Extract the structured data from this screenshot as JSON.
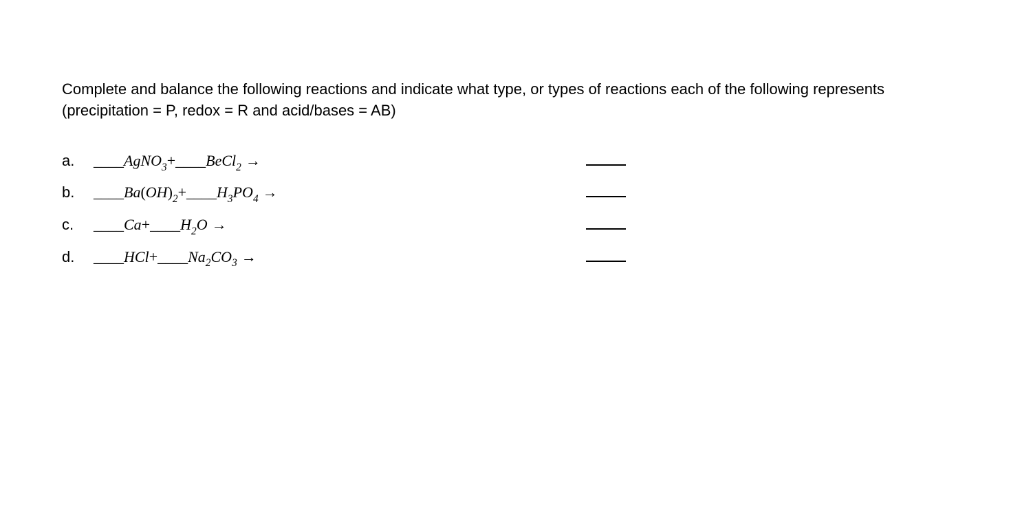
{
  "instructions": "Complete and balance the following reactions and indicate what type, or types of reactions each of the following represents (precipitation = P, redox = R and acid/bases = AB)",
  "problems": {
    "a": {
      "label": "a.",
      "r1": "AgNO",
      "r1sub": "3",
      "r2": "BeCl",
      "r2sub": "2"
    },
    "b": {
      "label": "b.",
      "r1a": "Ba",
      "r1b": "OH",
      "r1bsub": "2",
      "r2a": "H",
      "r2asub": "3",
      "r2b": "PO",
      "r2bsub": "4"
    },
    "c": {
      "label": "c.",
      "r1": "Ca",
      "r2a": "H",
      "r2asub": "2",
      "r2b": "O"
    },
    "d": {
      "label": "d.",
      "r1": "HCl",
      "r2a": "Na",
      "r2asub": "2",
      "r2b": "CO",
      "r2bsub": "3"
    }
  },
  "symbols": {
    "dash": "____",
    "plus": "+",
    "arrow": "→",
    "lparen": "(",
    "rparen": ")"
  }
}
